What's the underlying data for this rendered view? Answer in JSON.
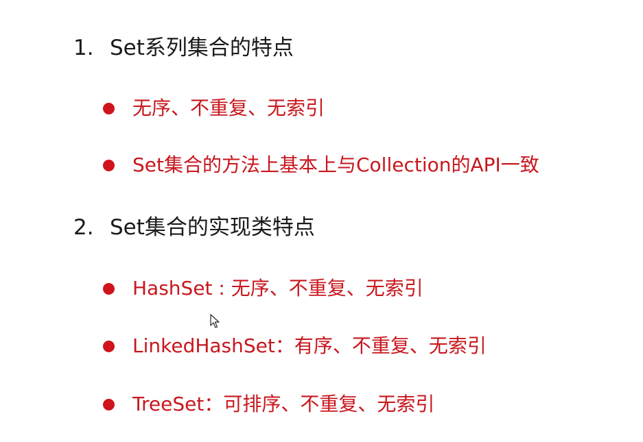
{
  "sections": [
    {
      "number": "1.",
      "title": "Set系列集合的特点",
      "items": [
        "无序、不重复、无索引",
        "Set集合的方法上基本上与Collection的API一致"
      ]
    },
    {
      "number": "2.",
      "title": "Set集合的实现类特点",
      "items": [
        "HashSet : 无序、不重复、无索引",
        "LinkedHashSet：有序、不重复、无索引",
        "TreeSet：可排序、不重复、无索引"
      ]
    }
  ],
  "colors": {
    "bullet": "#d0141c",
    "item_text": "#c8161d",
    "heading_text": "#1a1a1a"
  }
}
